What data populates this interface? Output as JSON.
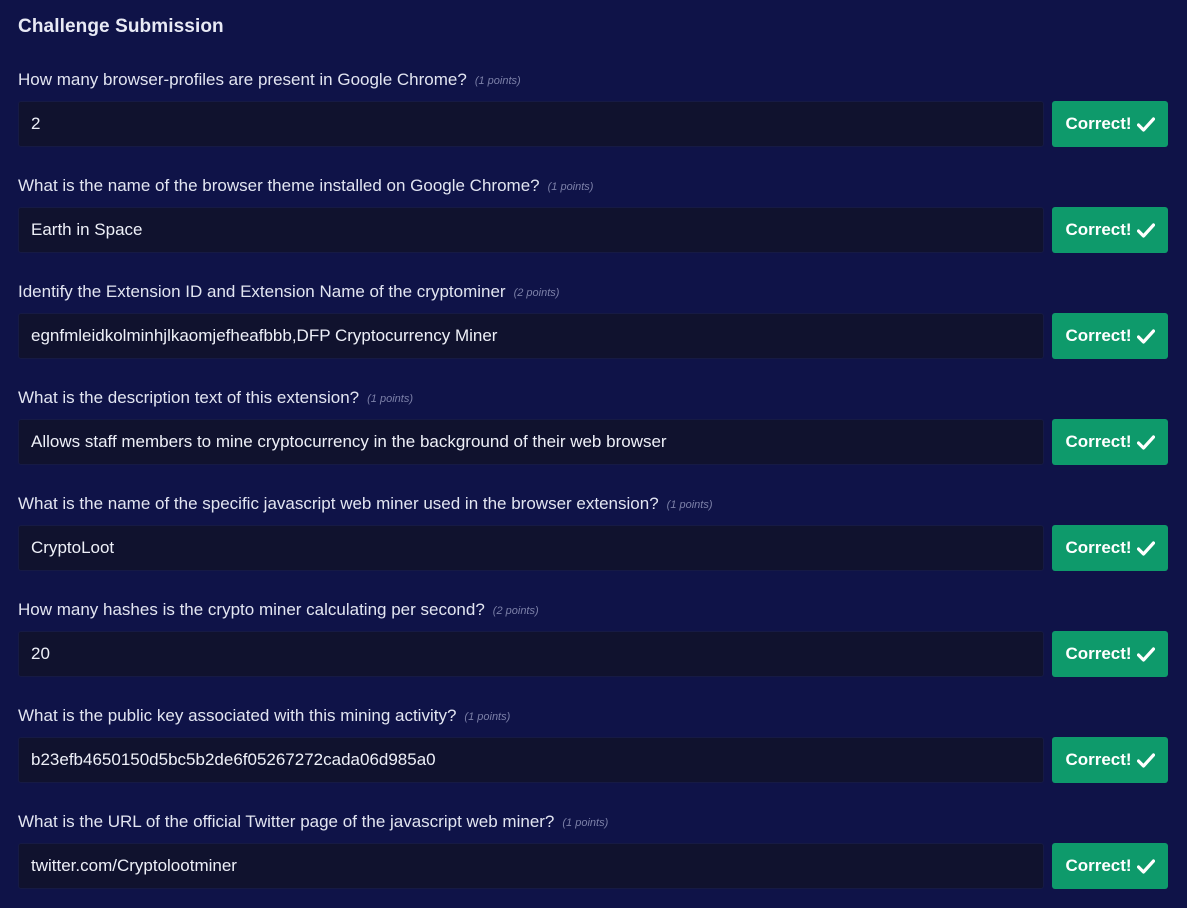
{
  "title": "Challenge Submission",
  "questions": [
    {
      "text": "How many browser-profiles are present in Google Chrome?",
      "points": "(1 points)",
      "answer": "2",
      "status": "Correct!"
    },
    {
      "text": "What is the name of the browser theme installed on Google Chrome?",
      "points": "(1 points)",
      "answer": "Earth in Space",
      "status": "Correct!"
    },
    {
      "text": "Identify the Extension ID and Extension Name of the cryptominer",
      "points": "(2 points)",
      "answer": "egnfmleidkolminhjlkaomjefheafbbb,DFP Cryptocurrency Miner",
      "status": "Correct!"
    },
    {
      "text": "What is the description text of this extension?",
      "points": "(1 points)",
      "answer": "Allows staff members to mine cryptocurrency in the background of their web browser",
      "status": "Correct!"
    },
    {
      "text": "What is the name of the specific javascript web miner used in the browser extension?",
      "points": "(1 points)",
      "answer": "CryptoLoot",
      "status": "Correct!"
    },
    {
      "text": "How many hashes is the crypto miner calculating per second?",
      "points": "(2 points)",
      "answer": "20",
      "status": "Correct!"
    },
    {
      "text": "What is the public key associated with this mining activity?",
      "points": "(1 points)",
      "answer": "b23efb4650150d5bc5b2de6f05267272cada06d985a0",
      "status": "Correct!"
    },
    {
      "text": "What is the URL of the official Twitter page of the javascript web miner?",
      "points": "(1 points)",
      "answer": "twitter.com/Cryptolootminer",
      "status": "Correct!"
    }
  ],
  "colors": {
    "background": "#0f1348",
    "input_background": "#10122e",
    "success": "#0e9a6b"
  },
  "icons": {
    "status": "check-icon"
  }
}
